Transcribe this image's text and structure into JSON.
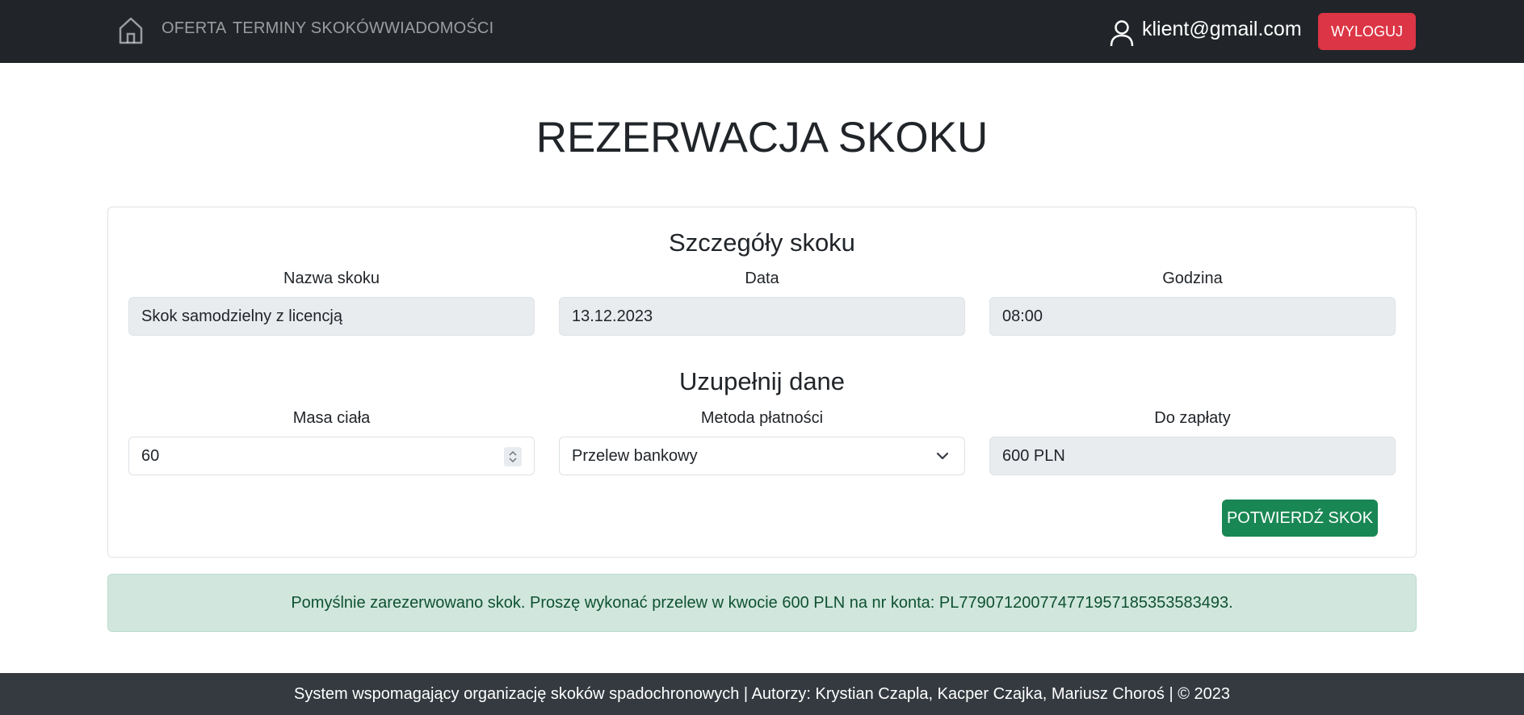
{
  "nav": {
    "home_icon": "home-icon",
    "links": [
      "OFERTA",
      "TERMINY SKOKÓW",
      "WIADOMOŚCI"
    ],
    "user_icon": "user-icon",
    "user_email": "klient@gmail.com",
    "logout_label": "WYLOGUJ"
  },
  "page_title": "REZERWACJA SKOKU",
  "details": {
    "title": "Szczegóły skoku",
    "name_label": "Nazwa skoku",
    "name_value": "Skok samodzielny z licencją",
    "date_label": "Data",
    "date_value": "13.12.2023",
    "time_label": "Godzina",
    "time_value": "08:00"
  },
  "form": {
    "title": "Uzupełnij dane",
    "weight_label": "Masa ciała",
    "weight_value": "60",
    "payment_label": "Metoda płatności",
    "payment_value": "Przelew bankowy",
    "amount_label": "Do zapłaty",
    "amount_value": "600 PLN",
    "confirm_label": "POTWIERDŹ SKOK"
  },
  "alert": {
    "message": "Pomyślnie zarezerwowano skok. Proszę wykonać przelew w kwocie 600 PLN na nr konta: PL779071200774771957185353583493."
  },
  "footer": {
    "text": "System wspomagający organizację skoków spadochronowych | Autorzy: Krystian Czapla, Kacper Czajka, Mariusz Choroś | © 2023"
  },
  "colors": {
    "navbar": "#212529",
    "danger": "#dc3545",
    "success": "#198754",
    "alert_bg": "#d1e7dd",
    "alert_text": "#0f5132",
    "footer": "#343a40"
  }
}
